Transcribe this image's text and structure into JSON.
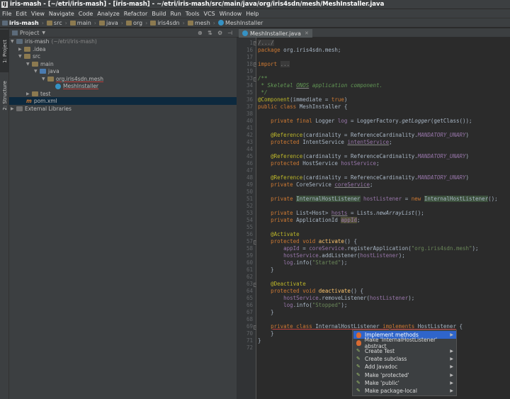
{
  "window_title": "iris-mash - [~/etri/iris-mash] - [iris-mash] - ~/etri/iris-mash/src/main/java/org/iris4sdn/mesh/MeshInstaller.java",
  "menu": [
    "File",
    "Edit",
    "View",
    "Navigate",
    "Code",
    "Analyze",
    "Refactor",
    "Build",
    "Run",
    "Tools",
    "VCS",
    "Window",
    "Help"
  ],
  "breadcrumbs": [
    "iris-mash",
    "src",
    "main",
    "java",
    "org",
    "iris4sdn",
    "mesh",
    "MeshInstaller"
  ],
  "left_tools": [
    "1: Project",
    "2: Structure"
  ],
  "project_panel": {
    "title": "Project",
    "tree": [
      {
        "label": "iris-mash",
        "extra": "(~/etri/iris-mash)"
      },
      {
        "label": ".idea"
      },
      {
        "label": "src"
      },
      {
        "label": "main"
      },
      {
        "label": "java"
      },
      {
        "label": "org.iris4sdn.mesh"
      },
      {
        "label": "MeshInstaller"
      },
      {
        "label": "test"
      },
      {
        "label": "pom.xml"
      },
      {
        "label": "External Libraries"
      }
    ]
  },
  "editor": {
    "tab": "MeshInstaller.java",
    "line_numbers": [
      "1",
      "16",
      "17",
      "",
      "18",
      "19",
      "",
      "33",
      "34",
      "35",
      "36",
      "37",
      "38",
      "",
      "40",
      "41",
      "",
      "42",
      "43",
      "",
      "44",
      "45",
      "",
      "46",
      "47",
      "",
      "48",
      "49",
      "",
      "50",
      "51",
      "",
      "52",
      "53",
      "",
      "54",
      "55",
      "56",
      "",
      "57",
      "58",
      "59",
      "60",
      "61",
      "62",
      "63",
      "",
      "64",
      "65",
      "66",
      "67",
      "68",
      "69",
      "",
      "70",
      "71",
      "72"
    ],
    "imports_label": "import ..."
  },
  "intention_popup": {
    "items": [
      {
        "label": "Implement methods",
        "icon": "bulb",
        "submenu": true
      },
      {
        "label": "Make 'InternalHostListener' abstract",
        "icon": "bulb",
        "submenu": false
      },
      {
        "label": "Create Test",
        "icon": "pen",
        "submenu": true
      },
      {
        "label": "Create subclass",
        "icon": "pen",
        "submenu": true
      },
      {
        "label": "Add Javadoc",
        "icon": "pen",
        "submenu": true
      },
      {
        "label": "Make 'protected'",
        "icon": "pen",
        "submenu": true
      },
      {
        "label": "Make 'public'",
        "icon": "pen",
        "submenu": true
      },
      {
        "label": "Make package-local",
        "icon": "pen",
        "submenu": true
      }
    ]
  }
}
